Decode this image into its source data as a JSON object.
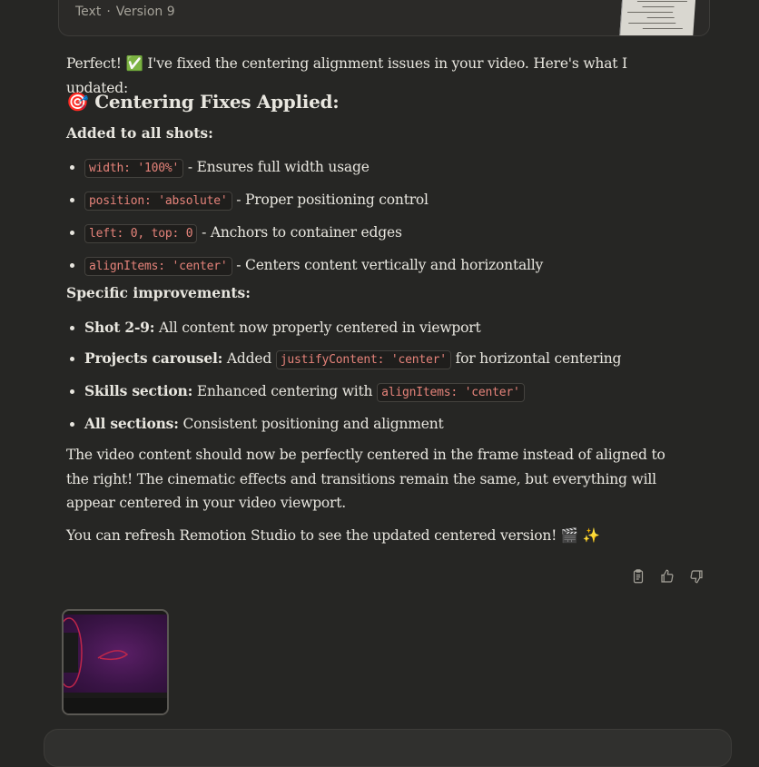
{
  "artifact": {
    "type": "Text",
    "separator": "·",
    "version": "Version 9"
  },
  "message": {
    "intro": "Perfect! ✅ I've fixed the centering alignment issues in your video. Here's what I updated:",
    "heading": "🎯 Centering Fixes Applied:",
    "added_heading": "Added to all shots:",
    "added_items": [
      {
        "code": "width: '100%'",
        "text": " - Ensures full width usage"
      },
      {
        "code": "position: 'absolute'",
        "text": " - Proper positioning control"
      },
      {
        "code": "left: 0, top: 0",
        "text": " - Anchors to container edges"
      },
      {
        "code": "alignItems: 'center'",
        "text": " - Centers content vertically and horizontally"
      }
    ],
    "specific_heading": "Specific improvements:",
    "specific_items": [
      {
        "bold": "Shot 2-9:",
        "text": " All content now properly centered in viewport"
      },
      {
        "bold": "Projects carousel:",
        "text": " Added ",
        "code": "justifyContent: 'center'",
        "after": " for horizontal centering"
      },
      {
        "bold": "Skills section:",
        "text": " Enhanced centering with ",
        "code": "alignItems: 'center'"
      },
      {
        "bold": "All sections:",
        "text": " Consistent positioning and alignment"
      }
    ],
    "para1": "The video content should now be perfectly centered in the frame instead of aligned to the right! The cinematic effects and transitions remain the same, but everything will appear centered in your video viewport.",
    "para2": "You can refresh Remotion Studio to see the updated centered version! 🎬 ✨"
  },
  "actions": {
    "copy": "copy-icon",
    "like": "thumbs-up-icon",
    "dislike": "thumbs-down-icon"
  },
  "colors": {
    "background": "#262624",
    "code": "#e5837a",
    "text": "#e8e6df"
  }
}
